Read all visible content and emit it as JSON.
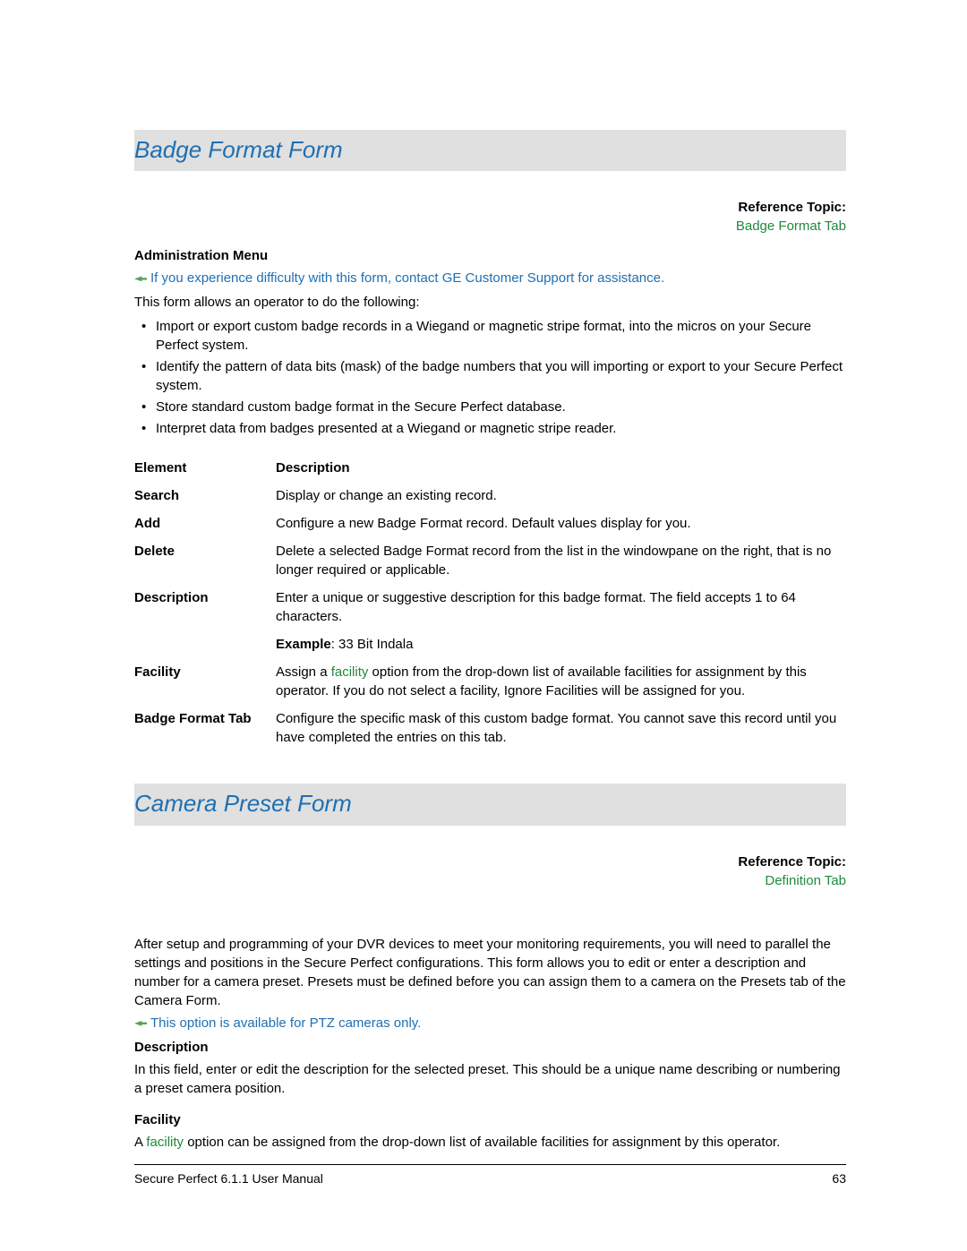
{
  "section1": {
    "heading": "Badge Format Form",
    "reference_label": "Reference Topic:",
    "reference_link": "Badge Format Tab",
    "admin_menu_label": "Administration Menu",
    "support_note": "If you experience difficulty with this form, contact GE Customer Support for assistance.",
    "intro": "This form allows an operator to do the following:",
    "bullets": [
      "Import or export custom badge records in a Wiegand or magnetic stripe format, into the micros on your Secure Perfect system.",
      "Identify the pattern of data bits (mask) of the badge numbers that you will importing or export to your Secure Perfect system.",
      "Store standard custom badge format in the Secure Perfect database.",
      "Interpret data from badges presented at a Wiegand or magnetic stripe reader."
    ],
    "table": {
      "header_element": "Element",
      "header_description": "Description",
      "rows": [
        {
          "el": "Search",
          "desc": "Display or change an existing record."
        },
        {
          "el": "Add",
          "desc": "Configure a new Badge Format record. Default values display for you."
        },
        {
          "el": "Delete",
          "desc": "Delete a selected Badge Format record from the list in the windowpane on the right, that is no longer required or applicable."
        },
        {
          "el": "Description",
          "desc": "Enter a unique or suggestive description for this badge format. The field accepts 1 to 64 characters.",
          "example_label": "Example",
          "example_text": ": 33 Bit Indala"
        },
        {
          "el": "Facility",
          "desc_pre": "Assign a ",
          "desc_link": "facility",
          "desc_post": " option from the drop-down list of available facilities for assignment by this operator. If you do not select a facility, Ignore Facilities will be assigned for you."
        },
        {
          "el": "Badge Format Tab",
          "desc": "Configure the specific mask of this custom badge format. You cannot save this record until you have completed the entries on this tab."
        }
      ]
    }
  },
  "section2": {
    "heading": "Camera Preset Form",
    "reference_label": "Reference Topic:",
    "reference_link": "Definition Tab",
    "body_para": "After setup and programming of your DVR devices to meet your monitoring requirements, you will need to parallel the settings and positions in the Secure Perfect configurations. This form allows you to edit or enter a description and number for a camera preset. Presets must be defined before you can assign them to a camera on the Presets tab of the Camera Form.",
    "ptz_note": "This option is available for PTZ cameras only.",
    "desc_heading": "Description",
    "desc_para": "In this field, enter or edit the description for the selected preset. This should be a unique name describing or numbering a preset camera position.",
    "facility_heading": "Facility",
    "facility_pre": "A ",
    "facility_link": "facility",
    "facility_post": " option can be assigned from the drop-down list of available facilities for assignment by this operator."
  },
  "footer": {
    "manual": "Secure Perfect 6.1.1 User Manual",
    "page": "63"
  }
}
